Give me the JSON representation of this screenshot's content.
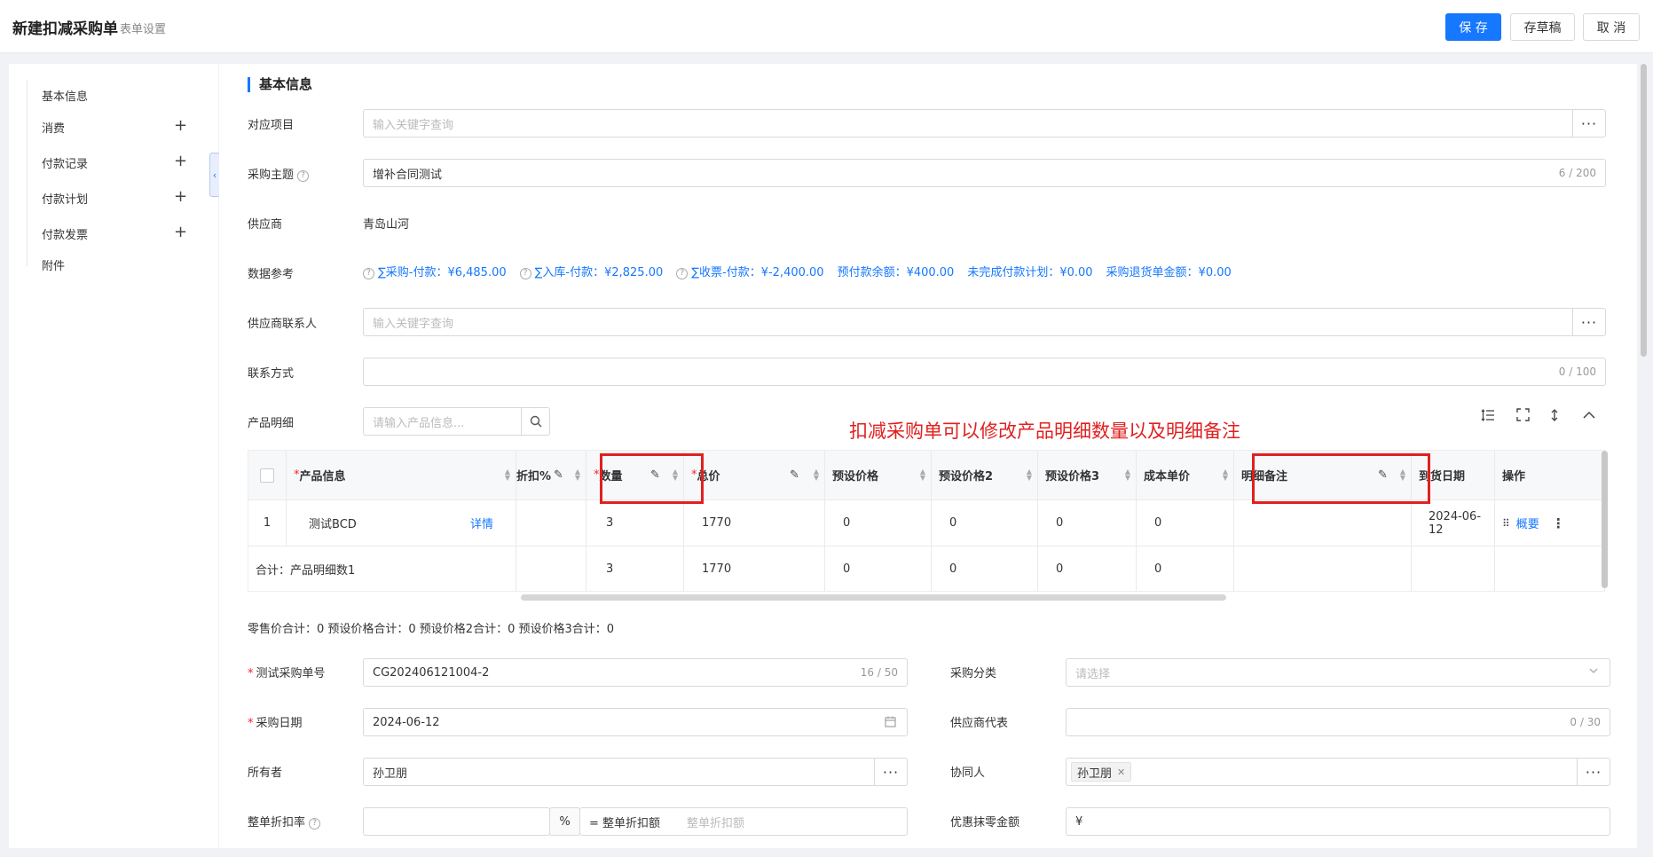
{
  "header": {
    "title": "新建扣减采购单",
    "subtitle": "表单设置",
    "save_label": "保 存",
    "draft_label": "存草稿",
    "cancel_label": "取 消"
  },
  "sidebar": {
    "items": [
      {
        "label": "基本信息",
        "has_add": false
      },
      {
        "label": "消费",
        "has_add": true
      },
      {
        "label": "付款记录",
        "has_add": true
      },
      {
        "label": "付款计划",
        "has_add": true
      },
      {
        "label": "付款发票",
        "has_add": true
      },
      {
        "label": "附件",
        "has_add": false
      }
    ],
    "add_glyph": "+",
    "collapse_glyph": "‹"
  },
  "form": {
    "section_title": "基本信息",
    "project": {
      "label": "对应项目",
      "placeholder": "输入关键字查询"
    },
    "subject": {
      "label": "采购主题",
      "value": "增补合同测试",
      "count": "6 / 200"
    },
    "supplier": {
      "label": "供应商",
      "value": "青岛山河"
    },
    "data_ref": {
      "label": "数据参考",
      "items": [
        "∑采购-付款：¥6,485.00",
        "∑入库-付款：¥2,825.00",
        "∑收票-付款：¥-2,400.00",
        "预付款余额：¥400.00",
        "未完成付款计划：¥0.00",
        "采购退货单金额：¥0.00"
      ]
    },
    "supplier_contact": {
      "label": "供应商联系人",
      "placeholder": "输入关键字查询"
    },
    "contact_method": {
      "label": "联系方式",
      "count": "0 / 100"
    },
    "product_detail": {
      "label": "产品明细",
      "search_placeholder": "请输入产品信息..."
    },
    "help_glyph": "?",
    "dots_glyph": "···"
  },
  "annotation": "扣减采购单可以修改产品明细数量以及明细备注",
  "table": {
    "headers": {
      "product": "产品信息",
      "discount": "折扣%",
      "qty": "数量",
      "total": "总价",
      "preset_price": "预设价格",
      "preset_price2": "预设价格2",
      "preset_price3": "预设价格3",
      "cost_price": "成本单价",
      "remark": "明细备注",
      "arrival_date": "到货日期",
      "actions": "操作"
    },
    "required_mark": "*",
    "row": {
      "index": "1",
      "product": "测试BCD",
      "detail_link": "详情",
      "qty": "3",
      "total": "1770",
      "preset_price": "0",
      "preset_price2": "0",
      "preset_price3": "0",
      "cost_price": "0",
      "remark": "",
      "arrival_date": "2024-06-12",
      "summary_link": "概要"
    },
    "total_row": {
      "label": "合计：产品明细数1",
      "qty": "3",
      "total": "1770",
      "preset_price": "0",
      "preset_price2": "0",
      "preset_price3": "0",
      "cost_price": "0"
    }
  },
  "summary_line": "零售价合计：0  预设价格合计：0  预设价格2合计：0  预设价格3合计：0",
  "lower": {
    "order_no": {
      "label": "测试采购单号",
      "value": "CG202406121004-2",
      "count": "16 / 50"
    },
    "category": {
      "label": "采购分类",
      "placeholder": "请选择"
    },
    "date": {
      "label": "采购日期",
      "value": "2024-06-12"
    },
    "supplier_rep": {
      "label": "供应商代表",
      "count": "0 / 30"
    },
    "owner": {
      "label": "所有者",
      "value": "孙卫朋"
    },
    "collaborator": {
      "label": "协同人",
      "tag": "孙卫朋"
    },
    "discount_rate": {
      "label": "整单折扣率",
      "percent": "%",
      "eq_label": "= 整单折扣额",
      "placeholder": "整单折扣额"
    },
    "rounding": {
      "label": "优惠抹零金额",
      "currency": "¥"
    }
  },
  "colors": {
    "primary": "#1677ff",
    "annotation": "#e02020",
    "required": "#f5222d"
  }
}
